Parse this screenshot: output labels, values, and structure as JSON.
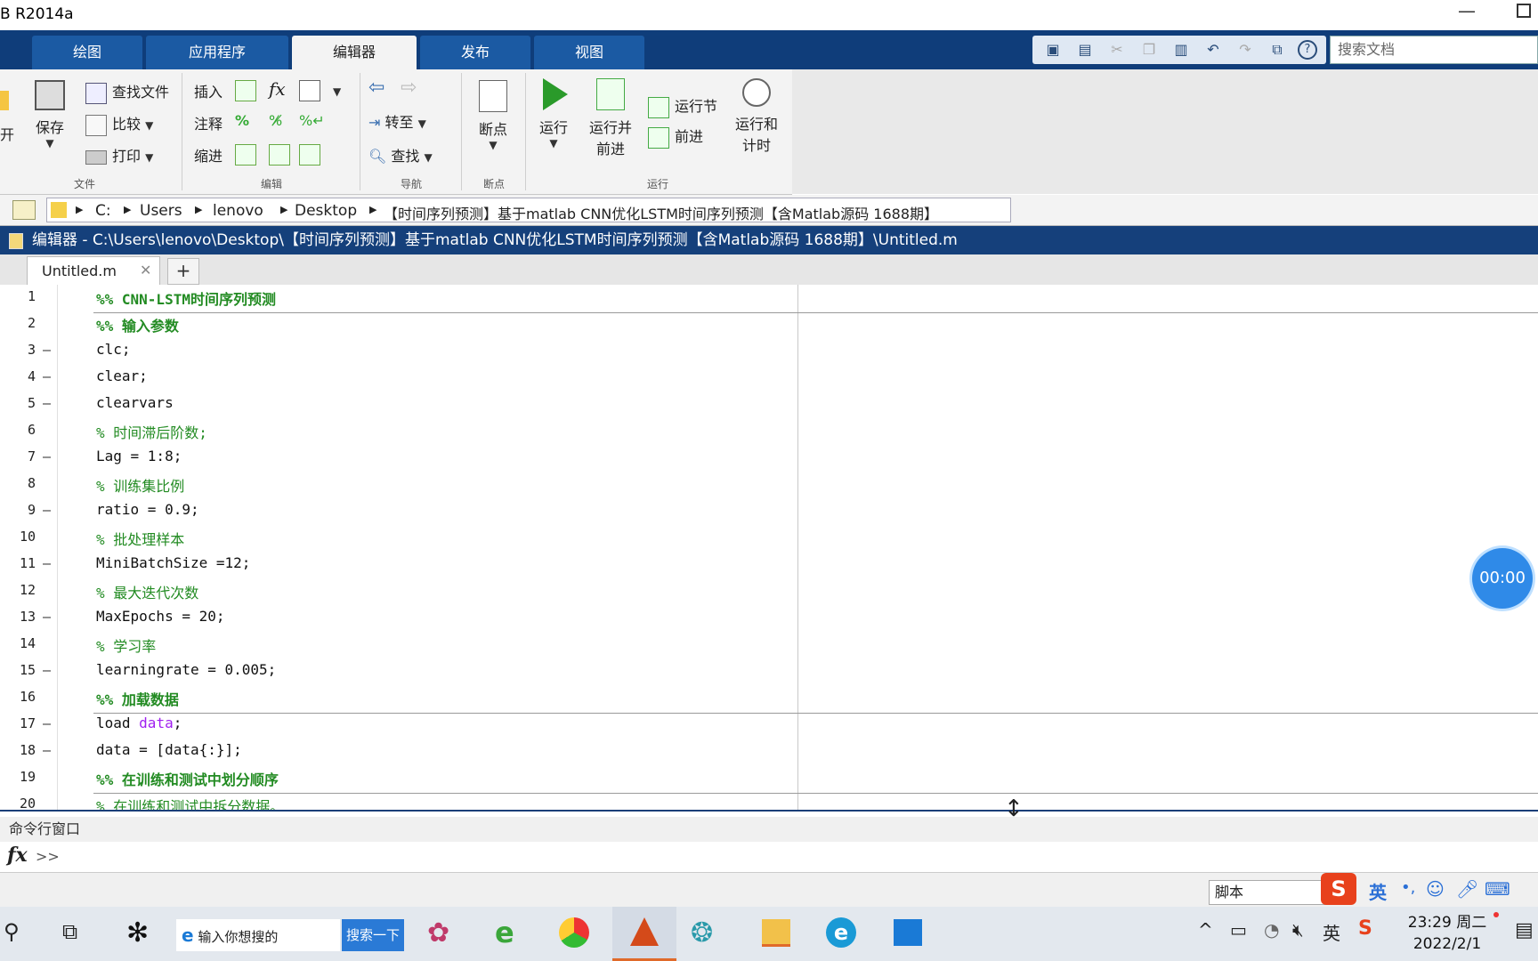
{
  "window": {
    "title": "B R2014a"
  },
  "ribbon_tabs": [
    "绘图",
    "应用程序",
    "编辑器",
    "发布",
    "视图"
  ],
  "active_tab": "编辑器",
  "search_docs": {
    "placeholder": "搜索文档"
  },
  "ribbon": {
    "file": {
      "open_partial": "开",
      "save": "保存",
      "find_files": "查找文件",
      "compare": "比较",
      "print": "打印",
      "label": "文件"
    },
    "edit": {
      "insert": "插入",
      "comment": "注释",
      "indent": "缩进",
      "label": "编辑",
      "fx": "fx"
    },
    "nav": {
      "goto": "转至",
      "find": "查找",
      "label": "导航"
    },
    "breakpoints": {
      "breakpoints": "断点",
      "label": "断点"
    },
    "run": {
      "run": "运行",
      "run_advance_1": "运行并",
      "run_advance_2": "前进",
      "run_section": "运行节",
      "advance": "前进",
      "run_time_1": "运行和",
      "run_time_2": "计时",
      "label": "运行"
    }
  },
  "path": {
    "items": [
      "C:",
      "Users",
      "lenovo",
      "Desktop",
      "【时间序列预测】基于matlab CNN优化LSTM时间序列预测【含Matlab源码 1688期】"
    ]
  },
  "editor": {
    "title": "编辑器 - C:\\Users\\lenovo\\Desktop\\【时间序列预测】基于matlab CNN优化LSTM时间序列预测【含Matlab源码 1688期】\\Untitled.m",
    "tab": "Untitled.m",
    "lines": [
      {
        "n": "1",
        "dash": "",
        "text": "%% CNN-LSTM时间序列预测",
        "type": "cell"
      },
      {
        "n": "2",
        "dash": "",
        "text": "%% 输入参数",
        "type": "cell"
      },
      {
        "n": "3",
        "dash": "—",
        "text": "clc;",
        "type": "code"
      },
      {
        "n": "4",
        "dash": "—",
        "text": "clear;",
        "type": "code"
      },
      {
        "n": "5",
        "dash": "—",
        "text": "clearvars",
        "type": "code"
      },
      {
        "n": "6",
        "dash": "",
        "text": "% 时间滞后阶数;",
        "type": "cmt"
      },
      {
        "n": "7",
        "dash": "—",
        "text": "Lag = 1:8;",
        "type": "code"
      },
      {
        "n": "8",
        "dash": "",
        "text": "% 训练集比例",
        "type": "cmt"
      },
      {
        "n": "9",
        "dash": "—",
        "text": "ratio = 0.9;",
        "type": "code"
      },
      {
        "n": "10",
        "dash": "",
        "text": "% 批处理样本",
        "type": "cmt"
      },
      {
        "n": "11",
        "dash": "—",
        "text": "MiniBatchSize =12;",
        "type": "code"
      },
      {
        "n": "12",
        "dash": "",
        "text": "% 最大迭代次数",
        "type": "cmt"
      },
      {
        "n": "13",
        "dash": "—",
        "text": "MaxEpochs = 20;",
        "type": "code"
      },
      {
        "n": "14",
        "dash": "",
        "text": "% 学习率",
        "type": "cmt"
      },
      {
        "n": "15",
        "dash": "—",
        "text": "learningrate = 0.005;",
        "type": "code"
      },
      {
        "n": "16",
        "dash": "",
        "text": "%% 加载数据",
        "type": "cell"
      },
      {
        "n": "17",
        "dash": "—",
        "text": "load data;",
        "type": "code"
      },
      {
        "n": "18",
        "dash": "—",
        "text": "data = [data{:}];",
        "type": "code"
      },
      {
        "n": "19",
        "dash": "",
        "text": "%% 在训练和测试中划分顺序",
        "type": "cell"
      },
      {
        "n": "20",
        "dash": "",
        "text": "% 在训练和测试中拆分数据。",
        "type": "cmt"
      }
    ]
  },
  "timer": "00:00",
  "command_window": {
    "title": "命令行窗口",
    "fx": "fx",
    "prompt": ">>"
  },
  "status": {
    "mode": "脚本",
    "ime_lang": "英"
  },
  "taskbar": {
    "search_placeholder": "输入你想搜的",
    "search_button": "搜索一下",
    "time": "23:29 周二",
    "date": "2022/2/1"
  }
}
